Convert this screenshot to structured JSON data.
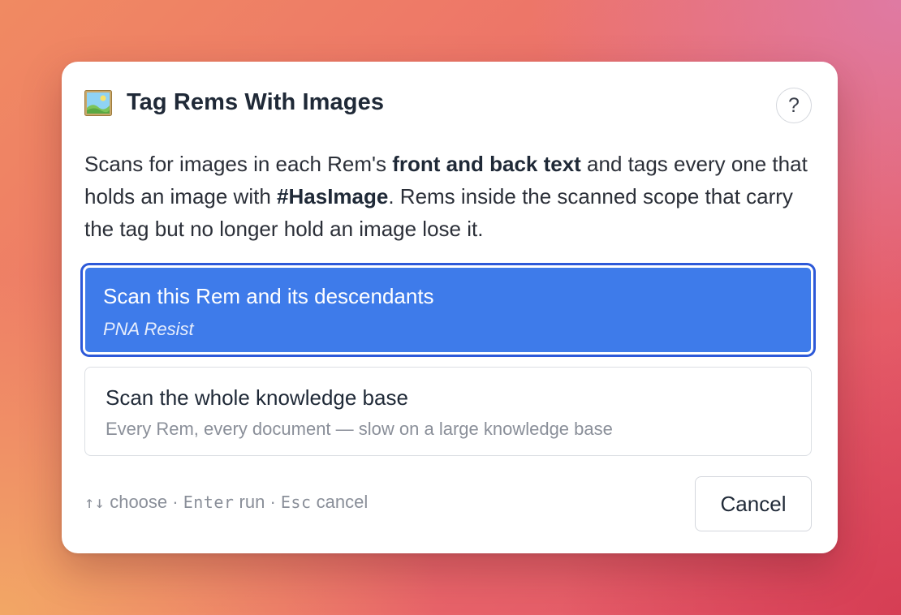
{
  "dialog": {
    "icon": "framed-picture-icon",
    "title": "Tag Rems With Images",
    "help_label": "?",
    "description": {
      "part1": "Scans for images in each Rem's ",
      "bold1": "front and back text",
      "part2": " and tags every one that holds an image with ",
      "bold2": "#HasImage",
      "part3": ". Rems inside the scanned scope that carry the tag but no longer hold an image lose it."
    },
    "options": [
      {
        "title": "Scan this Rem and its descendants",
        "subtitle": "PNA Resist",
        "selected": true
      },
      {
        "title": "Scan the whole knowledge base",
        "subtitle": "Every Rem, every document — slow on a large knowledge base",
        "selected": false
      }
    ],
    "footer": {
      "arrows_key": "↑↓",
      "arrows_action": " choose · ",
      "enter_key": "Enter",
      "enter_action": " run · ",
      "esc_key": "Esc",
      "esc_action": " cancel"
    },
    "cancel_label": "Cancel"
  },
  "colors": {
    "selected_bg": "#3e7bea",
    "focus_ring": "#2d59d8",
    "text_primary": "#1f2937",
    "text_muted": "#8a8f99"
  }
}
